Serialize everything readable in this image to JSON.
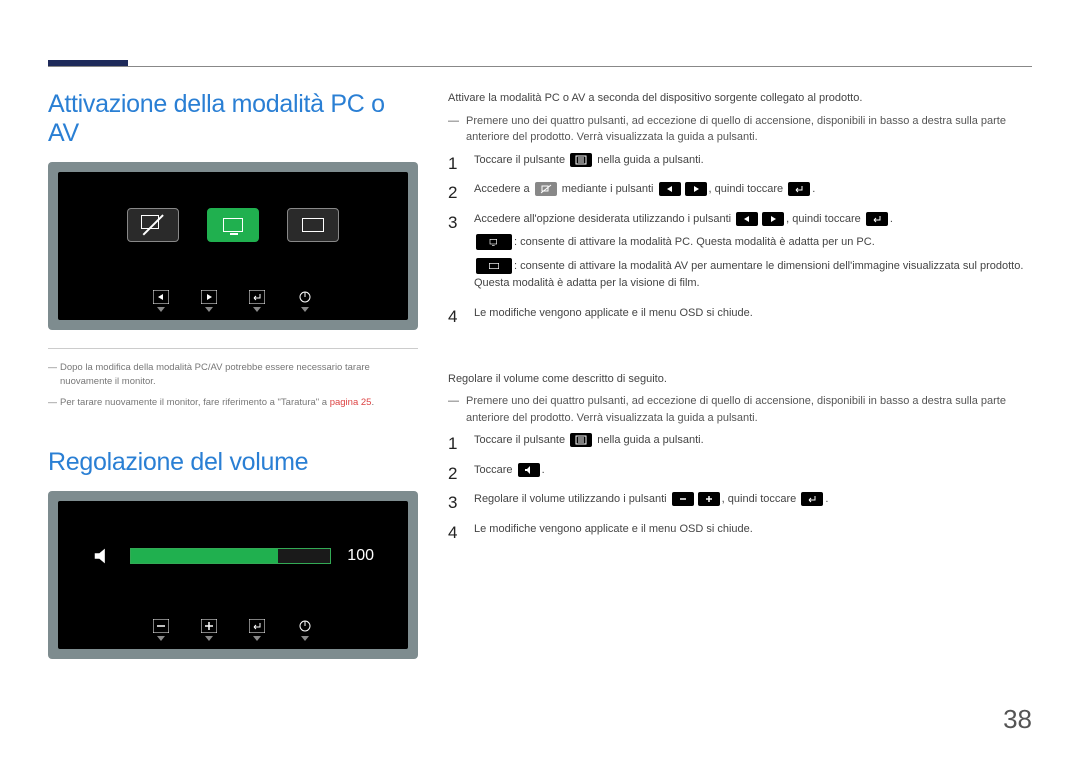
{
  "page_number": "38",
  "section1": {
    "title": "Attivazione della modalità PC o AV",
    "footnote1": "Dopo la modifica della modalità PC/AV potrebbe essere necessario tarare nuovamente il monitor.",
    "footnote2_a": "Per tarare nuovamente il monitor, fare riferimento a \"Taratura\" a ",
    "footnote2_link": "pagina 25",
    "footnote2_b": ".",
    "intro": "Attivare la modalità PC o AV a seconda del dispositivo sorgente collegato al prodotto.",
    "dashnote": "Premere uno dei quattro pulsanti, ad eccezione di quello di accensione, disponibili in basso a destra sulla parte anteriore del prodotto. Verrà visualizzata la guida a pulsanti.",
    "step1_a": "Toccare il pulsante ",
    "step1_b": " nella guida a pulsanti.",
    "step2_a": "Accedere a ",
    "step2_b": " mediante i pulsanti ",
    "step2_c": ", quindi toccare ",
    "step2_d": ".",
    "step3_a": "Accedere all'opzione desiderata utilizzando i pulsanti ",
    "step3_b": ", quindi toccare ",
    "step3_c": ".",
    "step3_note1": ": consente di attivare la modalità PC. Questa modalità è adatta per un PC.",
    "step3_note2": ": consente di attivare la modalità AV per aumentare le dimensioni dell'immagine visualizzata sul prodotto. Questa modalità è adatta per la visione di film.",
    "step4": "Le modifiche vengono applicate e il menu OSD si chiude."
  },
  "section2": {
    "title": "Regolazione del volume",
    "volume_value": "100",
    "intro": "Regolare il volume come descritto di seguito.",
    "dashnote": "Premere uno dei quattro pulsanti, ad eccezione di quello di accensione, disponibili in basso a destra sulla parte anteriore del prodotto. Verrà visualizzata la guida a pulsanti.",
    "step1_a": "Toccare il pulsante ",
    "step1_b": " nella guida a pulsanti.",
    "step2_a": "Toccare ",
    "step2_b": ".",
    "step3_a": "Regolare il volume utilizzando i pulsanti ",
    "step3_b": ", quindi toccare ",
    "step3_c": ".",
    "step4": "Le modifiche vengono applicate e il menu OSD si chiude."
  }
}
